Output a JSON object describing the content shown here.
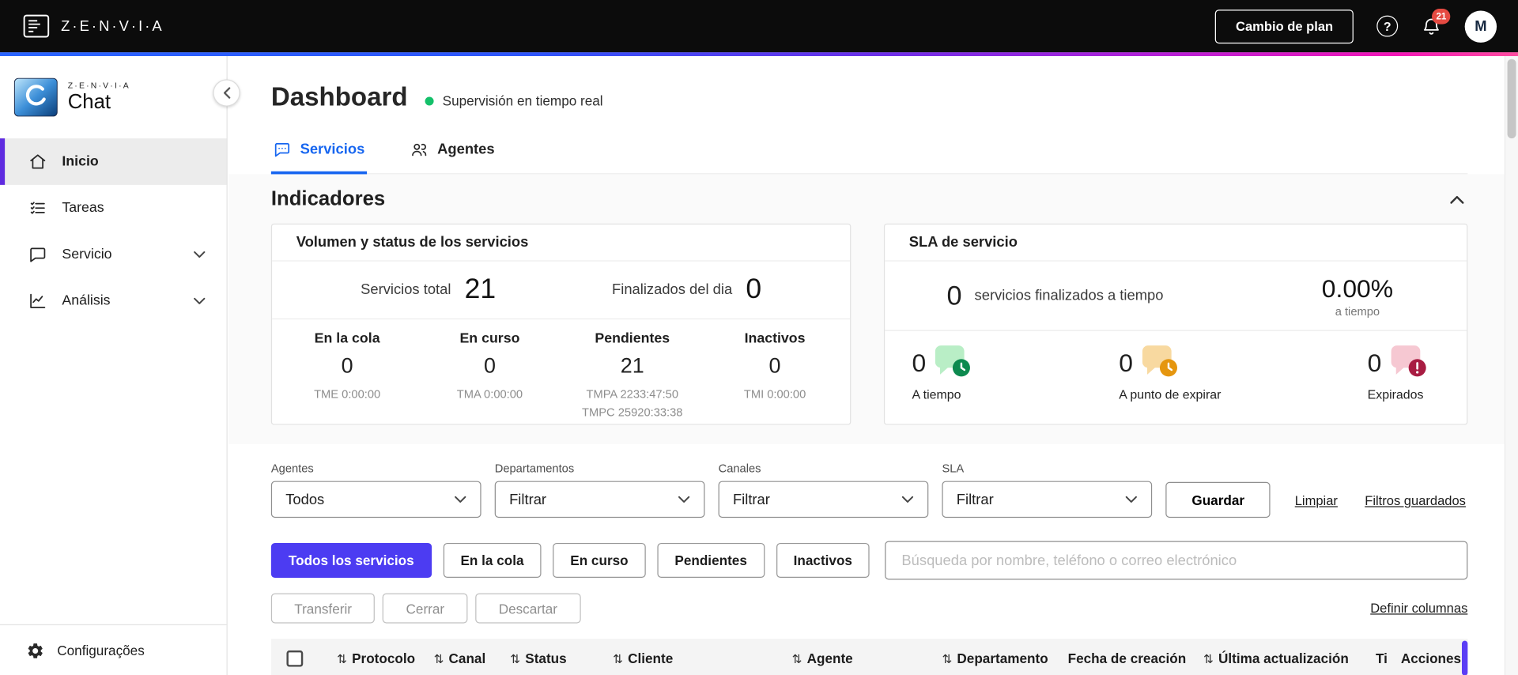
{
  "topbar": {
    "brand": "Z·E·N·V·I·A",
    "change_plan_button": "Cambio de plan",
    "notifications_badge": "21",
    "avatar_initial": "M"
  },
  "sidebar": {
    "logo_small": "Z·E·N·V·I·A",
    "logo_product": "Chat",
    "items": [
      {
        "label": "Inicio"
      },
      {
        "label": "Tareas"
      },
      {
        "label": "Servicio"
      },
      {
        "label": "Análisis"
      }
    ],
    "footer_label": "Configurações"
  },
  "page": {
    "title": "Dashboard",
    "live_status": "Supervisión en tiempo real"
  },
  "tabs": [
    {
      "label": "Servicios"
    },
    {
      "label": "Agentes"
    }
  ],
  "indicators": {
    "title": "Indicadores",
    "volume_card": {
      "title": "Volumen y status de los servicios",
      "total": {
        "label": "Servicios total",
        "value": "21"
      },
      "finished": {
        "label": "Finalizados del dia",
        "value": "0"
      },
      "columns": [
        {
          "label": "En la cola",
          "value": "0",
          "sub1": "TME 0:00:00",
          "sub2": ""
        },
        {
          "label": "En curso",
          "value": "0",
          "sub1": "TMA 0:00:00",
          "sub2": ""
        },
        {
          "label": "Pendientes",
          "value": "21",
          "sub1": "TMPA 2233:47:50",
          "sub2": "TMPC 25920:33:38"
        },
        {
          "label": "Inactivos",
          "value": "0",
          "sub1": "TMI 0:00:00",
          "sub2": ""
        }
      ]
    },
    "sla_card": {
      "title": "SLA de servicio",
      "finished_on_time": {
        "value": "0",
        "label": "servicios finalizados a tiempo"
      },
      "percent": {
        "value": "0.00%",
        "label": "a tiempo"
      },
      "stats": [
        {
          "value": "0",
          "label": "A tiempo"
        },
        {
          "value": "0",
          "label": "A punto de expirar"
        },
        {
          "value": "0",
          "label": "Expirados"
        }
      ]
    }
  },
  "filters": {
    "fields": [
      {
        "label": "Agentes",
        "value": "Todos"
      },
      {
        "label": "Departamentos",
        "value": "Filtrar"
      },
      {
        "label": "Canales",
        "value": "Filtrar"
      },
      {
        "label": "SLA",
        "value": "Filtrar"
      }
    ],
    "save_button": "Guardar",
    "clear_link": "Limpiar",
    "saved_filters_link": "Filtros guardados"
  },
  "service_tabs": {
    "buttons": [
      {
        "label": "Todos los servicios"
      },
      {
        "label": "En la cola"
      },
      {
        "label": "En curso"
      },
      {
        "label": "Pendientes"
      },
      {
        "label": "Inactivos"
      }
    ],
    "search_placeholder": "Búsqueda por nombre, teléfono o correo electrónico"
  },
  "bulk_actions": {
    "transfer": "Transferir",
    "close": "Cerrar",
    "discard": "Descartar",
    "define_columns_link": "Definir columnas"
  },
  "table": {
    "columns": [
      "Protocolo",
      "Canal",
      "Status",
      "Cliente",
      "Agente",
      "Departamento",
      "Fecha de creación",
      "Última actualización",
      "Ti",
      "Acciones"
    ]
  },
  "icons": {
    "zenvia-logo-icon": "squared-lines-mark",
    "help-icon": "question-circle",
    "bell-icon": "bell",
    "home-icon": "house",
    "tasks-icon": "checklist",
    "service-icon": "chat-bubble",
    "analysis-icon": "line-chart",
    "settings-icon": "gear",
    "sla-on-time-icon": "chat-bubble-clock-green",
    "sla-expiring-icon": "chat-bubble-alarm-amber",
    "sla-expired-icon": "chat-bubble-alert-red",
    "sort-icon": "⇅",
    "chevron-down-icon": "⌄",
    "chevron-up-icon": "⌃",
    "chevron-left-icon": "‹"
  },
  "colors": {
    "topbar_black": "#0c0c0c",
    "brand_blue": "#1766f0",
    "accent_indigo": "#4c3cf2",
    "active_border_purple": "#5f2be0",
    "live_green": "#14c06a",
    "sla_on_time": "#0d8a4f",
    "sla_expiring": "#e5960f",
    "sla_expired": "#a81c42",
    "badge_red": "#e54a42"
  }
}
